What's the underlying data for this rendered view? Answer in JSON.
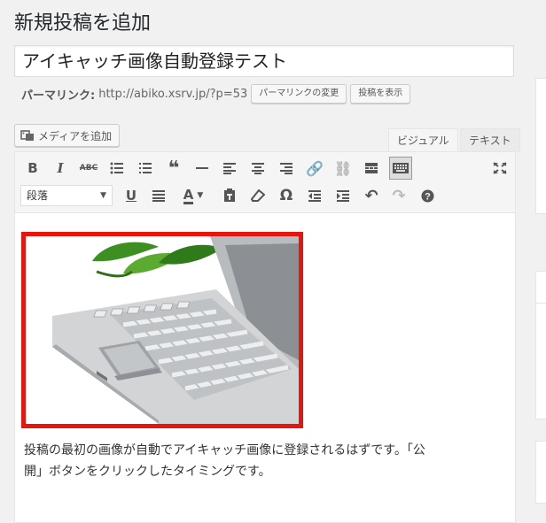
{
  "page": {
    "title": "新規投稿を追加"
  },
  "post": {
    "title": "アイキャッチ画像自動登録テスト"
  },
  "permalink": {
    "label": "パーマリンク:",
    "url": "http://abiko.xsrv.jp/?p=53",
    "change_button": "パーマリンクの変更",
    "view_button": "投稿を表示"
  },
  "media": {
    "add_button": "メディアを追加"
  },
  "tabs": {
    "visual": "ビジュアル",
    "text": "テキスト"
  },
  "toolbar": {
    "row1": [
      "bold-icon",
      "italic-icon",
      "strikethrough-icon",
      "bullet-list-icon",
      "numbered-list-icon",
      "blockquote-icon",
      "horizontal-rule-icon",
      "align-left-icon",
      "align-center-icon",
      "align-right-icon",
      "link-icon",
      "unlink-icon",
      "read-more-icon",
      "toolbar-toggle-icon",
      "fullscreen-icon"
    ],
    "row2": [
      "underline-icon",
      "justify-icon",
      "text-color-icon",
      "paste-text-icon",
      "clear-formatting-icon",
      "special-char-icon",
      "outdent-icon",
      "indent-icon",
      "undo-icon",
      "redo-icon",
      "help-icon"
    ],
    "format_select": "段落"
  },
  "content": {
    "paragraph_line1": "投稿の最初の画像が自動でアイキャッチ画像に登録されるはずです。「公",
    "paragraph_line2": "開」ボタンをクリックしたタイミングです。",
    "image_border_color": "#e8150f"
  }
}
